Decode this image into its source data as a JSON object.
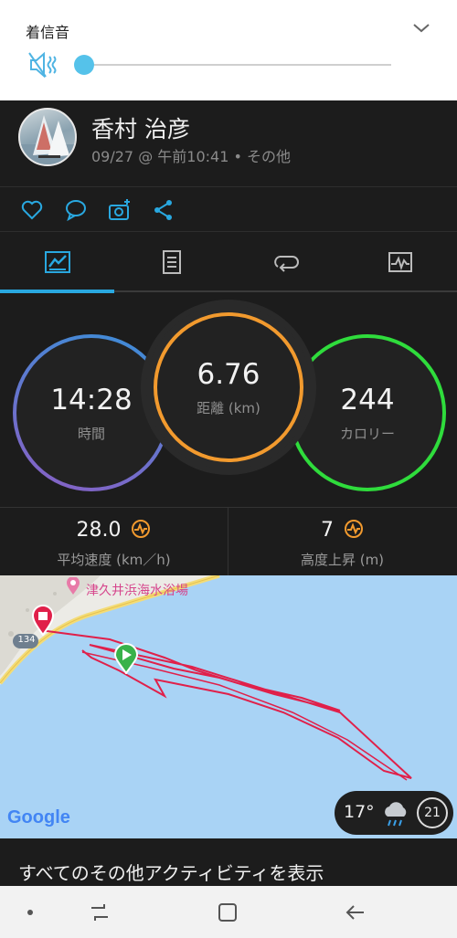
{
  "volume": {
    "title": "着信音",
    "level_fraction": 0.0
  },
  "activity": {
    "user_name": "香村 治彦",
    "meta": "09/27 @ 午前10:41 • その他"
  },
  "rings": {
    "time": {
      "value": "14:28",
      "label": "時間",
      "color": "#4a8fd6"
    },
    "distance": {
      "value": "6.76",
      "label": "距離 (km)",
      "color": "#f29a2e"
    },
    "calories": {
      "value": "244",
      "label": "カロリー",
      "color": "#2fdc3c"
    }
  },
  "substats": {
    "avg_speed": {
      "value": "28.0",
      "label": "平均速度 (km／h)"
    },
    "elevation_gain": {
      "value": "7",
      "label": "高度上昇 (m)"
    }
  },
  "map": {
    "place_label": "津久井浜海水浴場",
    "road_number": "134",
    "provider": "Google",
    "weather": {
      "temp": "17°",
      "badge": "21"
    }
  },
  "footer": {
    "all_activities_label": "すべてのその他アクティビティを表示"
  },
  "colors": {
    "accent": "#29a8e0",
    "route": "#e0204a",
    "volume_thumb": "#55c2ea"
  }
}
